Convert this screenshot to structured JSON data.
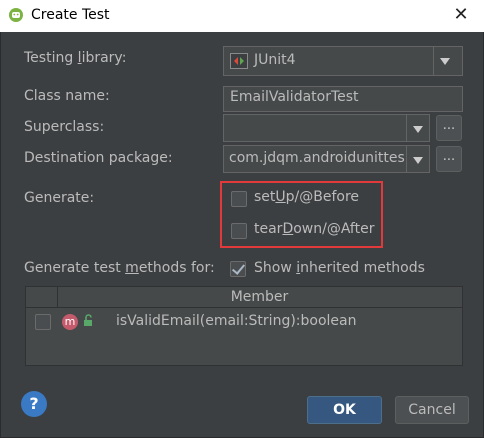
{
  "window": {
    "title": "Create Test",
    "close_glyph": "✕"
  },
  "form": {
    "testing_library_label_pre": "Testing ",
    "testing_library_label_u": "l",
    "testing_library_label_post": "ibrary:",
    "testing_library_value": "JUnit4",
    "class_name_label": "Class name:",
    "class_name_value": "EmailValidatorTest",
    "superclass_label": "Superclass:",
    "superclass_value": "",
    "destination_package_label": "Destination package:",
    "destination_package_value": "com.jdqm.androidunittest",
    "more_button": "...",
    "generate_label": "Generate:",
    "setup_pre": "set",
    "setup_u": "U",
    "setup_post": "p/@Before",
    "setup_checked": false,
    "teardown_pre": "tear",
    "teardown_u": "D",
    "teardown_post": "own/@After",
    "teardown_checked": false,
    "generate_methods_pre": "Generate test ",
    "generate_methods_u": "m",
    "generate_methods_post": "ethods for:",
    "show_inherited_pre": "Show ",
    "show_inherited_u": "i",
    "show_inherited_post": "nherited methods",
    "show_inherited_checked": true
  },
  "table": {
    "header_member": "Member",
    "rows": [
      {
        "badge": "m",
        "method": "isValidEmail(email:String):boolean",
        "checked": false
      }
    ]
  },
  "buttons": {
    "help": "?",
    "ok": "OK",
    "cancel": "Cancel"
  },
  "colors": {
    "background": "#3c3f41",
    "highlight_box": "#e23a3a",
    "ok_button": "#365880",
    "method_badge": "#c45b6c"
  },
  "icons": {
    "app": "android-icon",
    "library": "junit-icon",
    "method": "method-icon",
    "visibility": "lock-open-icon",
    "help": "help-icon"
  }
}
